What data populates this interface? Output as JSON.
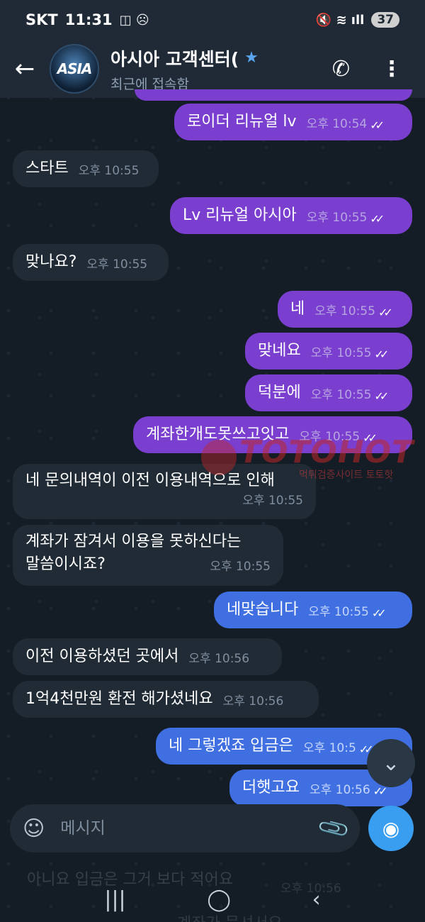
{
  "status_bar": {
    "carrier": "SKT",
    "time": "11:31",
    "left_icons": "◫ ☹",
    "right_icons": "🔇 ≋ ıll",
    "battery": "37"
  },
  "header": {
    "back_icon": "←",
    "avatar_text": "ASIA",
    "title": "아시아 고객센터(",
    "star": "★",
    "subtitle": "최근에 접속함",
    "call_icon": "✆",
    "more_icon": "⋮"
  },
  "messages": [
    {
      "text": "로이더 리뉴얼 lv",
      "time": "오후 10:54",
      "ticks": "✓✓"
    },
    {
      "text": "스타트",
      "time": "오후 10:55"
    },
    {
      "text": "Lv 리뉴얼 아시아",
      "time": "오후 10:55",
      "ticks": "✓✓"
    },
    {
      "text": "맞나요?",
      "time": "오후 10:55"
    },
    {
      "text": "네",
      "time": "오후 10:55",
      "ticks": "✓✓"
    },
    {
      "text": "맞네요",
      "time": "오후 10:55",
      "ticks": "✓✓"
    },
    {
      "text": "덕분에",
      "time": "오후 10:55",
      "ticks": "✓✓"
    },
    {
      "text": "계좌한개도못쓰고잇고",
      "time": "오후 10:55",
      "ticks": "✓✓"
    },
    {
      "text": "네 문의내역이 이전 이용내역으로 인해",
      "time": "오후 10:55"
    },
    {
      "text_line1": "계좌가 잠겨서 이용을 못하신다는",
      "text_line2": "말씀이시죠?",
      "time": "오후 10:55"
    },
    {
      "text": "네맞습니다",
      "time": "오후 10:55",
      "ticks": "✓✓"
    },
    {
      "text": "이전 이용하셨던 곳에서",
      "time": "오후 10:56"
    },
    {
      "text": "1억4천만원 환전 해가셨네요",
      "time": "오후 10:56"
    },
    {
      "text": "네 그렇겠죠 입금은",
      "time": "오후 10:5",
      "ticks": "✓✓"
    },
    {
      "text": "더햇고요",
      "time": "오후 10:56",
      "ticks": "✓✓"
    }
  ],
  "watermark": {
    "logo": "TOTOHOT",
    "sub": "먹튀검증사이트 토토핫"
  },
  "scroll_down_icon": "⌄",
  "input": {
    "placeholder": "메시지",
    "sticker_icon": "☺",
    "attach_icon": "📎",
    "camera_icon": "◉"
  },
  "faded": {
    "msg": "아니요 입금은 그거 보다 적어요",
    "time": "오후 10:56",
    "msg2": "계좌가 묶셔서요"
  },
  "nav": {
    "recent": "|||",
    "home": "◯",
    "back": "‹"
  }
}
